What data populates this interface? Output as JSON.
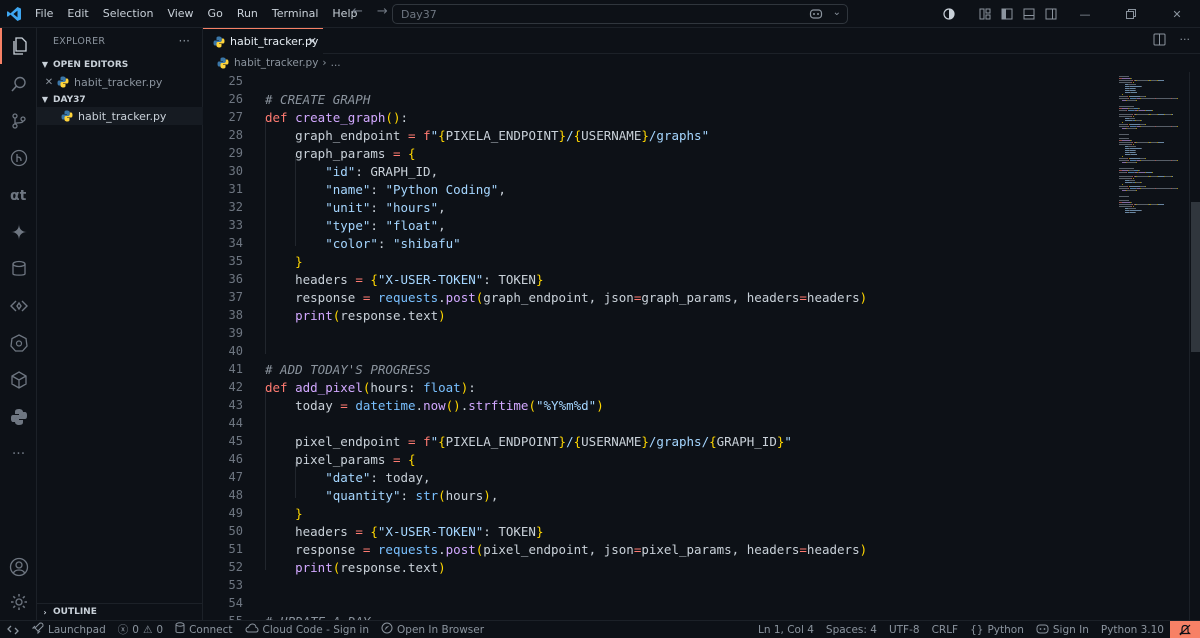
{
  "titlebar": {
    "menu": [
      "File",
      "Edit",
      "Selection",
      "View",
      "Go",
      "Run",
      "Terminal",
      "Help"
    ],
    "search_text": "Day37"
  },
  "sidebar": {
    "title": "EXPLORER",
    "open_editors_label": "OPEN EDITORS",
    "open_editor_file": "habit_tracker.py",
    "folder_label": "DAY37",
    "folder_file": "habit_tracker.py",
    "outline_label": "OUTLINE"
  },
  "tab": {
    "label": "habit_tracker.py"
  },
  "breadcrumb": {
    "file": "habit_tracker.py",
    "sep": "›",
    "rest": "..."
  },
  "editor": {
    "first_line": 25,
    "lines": [
      [],
      [
        [
          "c",
          "# CREATE GRAPH"
        ]
      ],
      [
        [
          "k",
          "def "
        ],
        [
          "f",
          "create_graph"
        ],
        [
          "b",
          "()"
        ],
        [
          "p",
          ":"
        ]
      ],
      [
        [
          "p",
          "    graph_endpoint "
        ],
        [
          "o",
          "="
        ],
        [
          "p",
          " "
        ],
        [
          "k",
          "f"
        ],
        [
          "s",
          "\""
        ],
        [
          "b",
          "{"
        ],
        [
          "p",
          "PIXELA_ENDPOINT"
        ],
        [
          "b",
          "}"
        ],
        [
          "s",
          "/"
        ],
        [
          "b",
          "{"
        ],
        [
          "p",
          "USERNAME"
        ],
        [
          "b",
          "}"
        ],
        [
          "s",
          "/graphs\""
        ]
      ],
      [
        [
          "p",
          "    graph_params "
        ],
        [
          "o",
          "="
        ],
        [
          "p",
          " "
        ],
        [
          "b",
          "{"
        ]
      ],
      [
        [
          "p",
          "        "
        ],
        [
          "s",
          "\"id\""
        ],
        [
          "p",
          ": GRAPH_ID,"
        ]
      ],
      [
        [
          "p",
          "        "
        ],
        [
          "s",
          "\"name\""
        ],
        [
          "p",
          ": "
        ],
        [
          "s",
          "\"Python Coding\""
        ],
        [
          "p",
          ","
        ]
      ],
      [
        [
          "p",
          "        "
        ],
        [
          "s",
          "\"unit\""
        ],
        [
          "p",
          ": "
        ],
        [
          "s",
          "\"hours\""
        ],
        [
          "p",
          ","
        ]
      ],
      [
        [
          "p",
          "        "
        ],
        [
          "s",
          "\"type\""
        ],
        [
          "p",
          ": "
        ],
        [
          "s",
          "\"float\""
        ],
        [
          "p",
          ","
        ]
      ],
      [
        [
          "p",
          "        "
        ],
        [
          "s",
          "\"color\""
        ],
        [
          "p",
          ": "
        ],
        [
          "s",
          "\"shibafu\""
        ]
      ],
      [
        [
          "p",
          "    "
        ],
        [
          "b",
          "}"
        ]
      ],
      [
        [
          "p",
          "    headers "
        ],
        [
          "o",
          "="
        ],
        [
          "p",
          " "
        ],
        [
          "b",
          "{"
        ],
        [
          "s",
          "\"X-USER-TOKEN\""
        ],
        [
          "p",
          ": TOKEN"
        ],
        [
          "b",
          "}"
        ]
      ],
      [
        [
          "p",
          "    response "
        ],
        [
          "o",
          "="
        ],
        [
          "p",
          " "
        ],
        [
          "n",
          "requests"
        ],
        [
          "p",
          "."
        ],
        [
          "f",
          "post"
        ],
        [
          "b",
          "("
        ],
        [
          "p",
          "graph_endpoint, json"
        ],
        [
          "o",
          "="
        ],
        [
          "p",
          "graph_params, headers"
        ],
        [
          "o",
          "="
        ],
        [
          "p",
          "headers"
        ],
        [
          "b",
          ")"
        ]
      ],
      [
        [
          "p",
          "    "
        ],
        [
          "f",
          "print"
        ],
        [
          "b",
          "("
        ],
        [
          "p",
          "response.text"
        ],
        [
          "b",
          ")"
        ]
      ],
      [],
      [],
      [
        [
          "c",
          "# ADD TODAY'S PROGRESS"
        ]
      ],
      [
        [
          "k",
          "def "
        ],
        [
          "f",
          "add_pixel"
        ],
        [
          "b",
          "("
        ],
        [
          "p",
          "hours: "
        ],
        [
          "m",
          "float"
        ],
        [
          "b",
          ")"
        ],
        [
          "p",
          ":"
        ]
      ],
      [
        [
          "p",
          "    today "
        ],
        [
          "o",
          "="
        ],
        [
          "p",
          " "
        ],
        [
          "n",
          "datetime"
        ],
        [
          "p",
          "."
        ],
        [
          "f",
          "now"
        ],
        [
          "b",
          "()"
        ],
        [
          "p",
          "."
        ],
        [
          "f",
          "strftime"
        ],
        [
          "b",
          "("
        ],
        [
          "s",
          "\"%Y%m%d\""
        ],
        [
          "b",
          ")"
        ]
      ],
      [],
      [
        [
          "p",
          "    pixel_endpoint "
        ],
        [
          "o",
          "="
        ],
        [
          "p",
          " "
        ],
        [
          "k",
          "f"
        ],
        [
          "s",
          "\""
        ],
        [
          "b",
          "{"
        ],
        [
          "p",
          "PIXELA_ENDPOINT"
        ],
        [
          "b",
          "}"
        ],
        [
          "s",
          "/"
        ],
        [
          "b",
          "{"
        ],
        [
          "p",
          "USERNAME"
        ],
        [
          "b",
          "}"
        ],
        [
          "s",
          "/graphs/"
        ],
        [
          "b",
          "{"
        ],
        [
          "p",
          "GRAPH_ID"
        ],
        [
          "b",
          "}"
        ],
        [
          "s",
          "\""
        ]
      ],
      [
        [
          "p",
          "    pixel_params "
        ],
        [
          "o",
          "="
        ],
        [
          "p",
          " "
        ],
        [
          "b",
          "{"
        ]
      ],
      [
        [
          "p",
          "        "
        ],
        [
          "s",
          "\"date\""
        ],
        [
          "p",
          ": today,"
        ]
      ],
      [
        [
          "p",
          "        "
        ],
        [
          "s",
          "\"quantity\""
        ],
        [
          "p",
          ": "
        ],
        [
          "m",
          "str"
        ],
        [
          "b",
          "("
        ],
        [
          "p",
          "hours"
        ],
        [
          "b",
          ")"
        ],
        [
          "p",
          ","
        ]
      ],
      [
        [
          "p",
          "    "
        ],
        [
          "b",
          "}"
        ]
      ],
      [
        [
          "p",
          "    headers "
        ],
        [
          "o",
          "="
        ],
        [
          "p",
          " "
        ],
        [
          "b",
          "{"
        ],
        [
          "s",
          "\"X-USER-TOKEN\""
        ],
        [
          "p",
          ": TOKEN"
        ],
        [
          "b",
          "}"
        ]
      ],
      [
        [
          "p",
          "    response "
        ],
        [
          "o",
          "="
        ],
        [
          "p",
          " "
        ],
        [
          "n",
          "requests"
        ],
        [
          "p",
          "."
        ],
        [
          "f",
          "post"
        ],
        [
          "b",
          "("
        ],
        [
          "p",
          "pixel_endpoint, json"
        ],
        [
          "o",
          "="
        ],
        [
          "p",
          "pixel_params, headers"
        ],
        [
          "o",
          "="
        ],
        [
          "p",
          "headers"
        ],
        [
          "b",
          ")"
        ]
      ],
      [
        [
          "p",
          "    "
        ],
        [
          "f",
          "print"
        ],
        [
          "b",
          "("
        ],
        [
          "p",
          "response.text"
        ],
        [
          "b",
          ")"
        ]
      ],
      [],
      [],
      [
        [
          "c",
          "# UPDATE A DAY"
        ]
      ]
    ]
  },
  "statusbar": {
    "launchpad": "Launchpad",
    "errors": "0",
    "warnings": "0",
    "connect": "Connect",
    "cloud_code": "Cloud Code - Sign in",
    "open_browser": "Open In Browser",
    "position": "Ln 1, Col 4",
    "spaces": "Spaces: 4",
    "encoding": "UTF-8",
    "eol": "CRLF",
    "language": "Python",
    "sign_in": "Sign In",
    "interpreter": "Python 3.10"
  },
  "colors": {
    "accent": "#f78166",
    "background": "#0d1117",
    "keyword": "#ff7b72",
    "function": "#d2a8ff",
    "string": "#a5d6ff",
    "comment": "#8b949e",
    "bracket": "#ffd700",
    "builtin": "#79c0ff"
  }
}
